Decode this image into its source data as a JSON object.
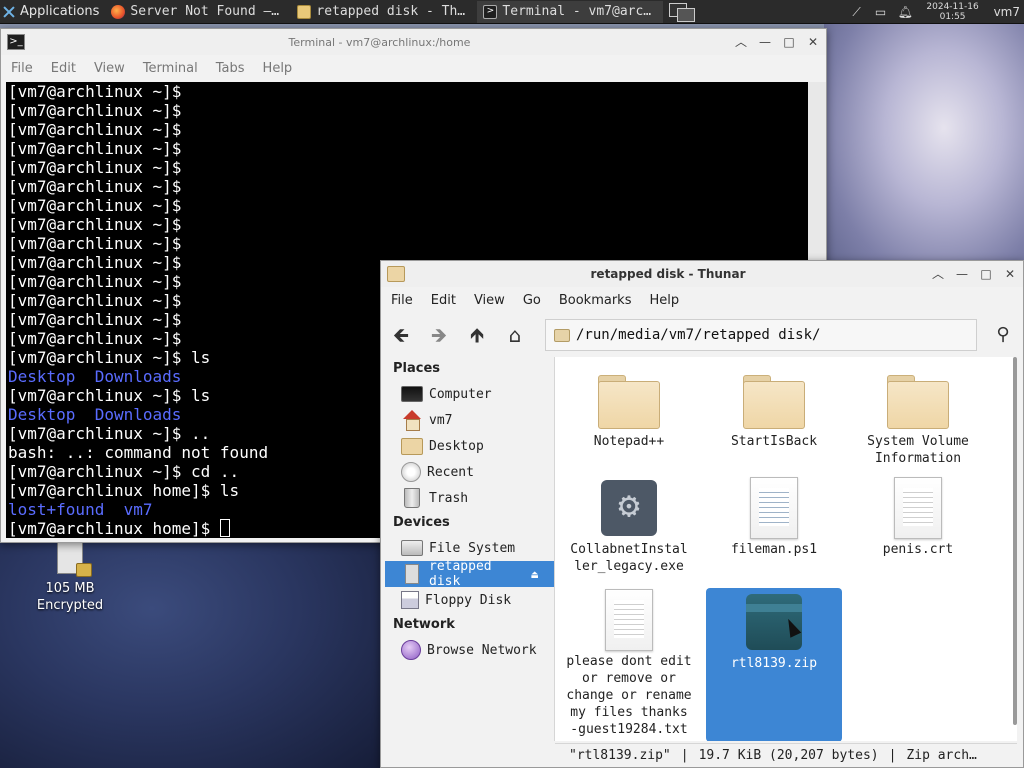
{
  "panel": {
    "applications_label": "Applications",
    "tasks": [
      {
        "label": "Server Not Found —…",
        "icon": "firefox-icon"
      },
      {
        "label": "retapped disk - Th…",
        "icon": "folder-icon"
      },
      {
        "label": "Terminal - vm7@arc…",
        "icon": "terminal-icon"
      }
    ],
    "clock_date": "2024-11-16",
    "clock_time": "01:55",
    "user": "vm7"
  },
  "terminal": {
    "title": "Terminal - vm7@archlinux:/home",
    "menu": [
      "File",
      "Edit",
      "View",
      "Terminal",
      "Tabs",
      "Help"
    ],
    "prompt_home": "[vm7@archlinux ~]$",
    "lines": [
      "[vm7@archlinux ~]$",
      "[vm7@archlinux ~]$",
      "[vm7@archlinux ~]$",
      "[vm7@archlinux ~]$",
      "[vm7@archlinux ~]$",
      "[vm7@archlinux ~]$",
      "[vm7@archlinux ~]$",
      "[vm7@archlinux ~]$",
      "[vm7@archlinux ~]$",
      "[vm7@archlinux ~]$",
      "[vm7@archlinux ~]$",
      "[vm7@archlinux ~]$",
      "[vm7@archlinux ~]$",
      "[vm7@archlinux ~]$",
      "[vm7@archlinux ~]$ ls",
      "Desktop  Downloads",
      "[vm7@archlinux ~]$ ls",
      "Desktop  Downloads",
      "[vm7@archlinux ~]$ ..",
      "bash: ..: command not found",
      "[vm7@archlinux ~]$ cd ..",
      "[vm7@archlinux home]$ ls",
      "lost+found  vm7",
      "[vm7@archlinux home]$ "
    ],
    "blue_lines": [
      15,
      17,
      22
    ]
  },
  "thunar": {
    "title": "retapped disk - Thunar",
    "menu": [
      "File",
      "Edit",
      "View",
      "Go",
      "Bookmarks",
      "Help"
    ],
    "path": "/run/media/vm7/retapped disk/",
    "sidebar": {
      "places_header": "Places",
      "places": [
        {
          "label": "Computer",
          "icon": "computer-icon"
        },
        {
          "label": "vm7",
          "icon": "home-icon"
        },
        {
          "label": "Desktop",
          "icon": "folder-icon"
        },
        {
          "label": "Recent",
          "icon": "recent-icon"
        },
        {
          "label": "Trash",
          "icon": "trash-icon"
        }
      ],
      "devices_header": "Devices",
      "devices": [
        {
          "label": "File System",
          "icon": "disk-icon"
        },
        {
          "label": "retapped disk",
          "icon": "usb-icon",
          "selected": true
        },
        {
          "label": "Floppy Disk",
          "icon": "floppy-icon"
        }
      ],
      "network_header": "Network",
      "network": [
        {
          "label": "Browse Network",
          "icon": "network-icon"
        }
      ]
    },
    "files": [
      {
        "label": "Notepad++",
        "icon": "folder"
      },
      {
        "label": "StartIsBack",
        "icon": "folder"
      },
      {
        "label": "System Volume Information",
        "icon": "folder"
      },
      {
        "label": "CollabnetInstaller_legacy.exe",
        "icon": "gear"
      },
      {
        "label": "fileman.ps1",
        "icon": "script"
      },
      {
        "label": "penis.crt",
        "icon": "doc"
      },
      {
        "label": "please dont edit or remove or change or rename my files thanks -guest19284.txt",
        "icon": "doc"
      },
      {
        "label": "rtl8139.zip",
        "icon": "zip",
        "selected": true
      }
    ],
    "status": {
      "name": "\"rtl8139.zip\"",
      "size": "19.7 KiB (20,207 bytes)",
      "type": "Zip arch…"
    }
  },
  "desktop_icon": {
    "line1": "105 MB",
    "line2": "Encrypted"
  }
}
